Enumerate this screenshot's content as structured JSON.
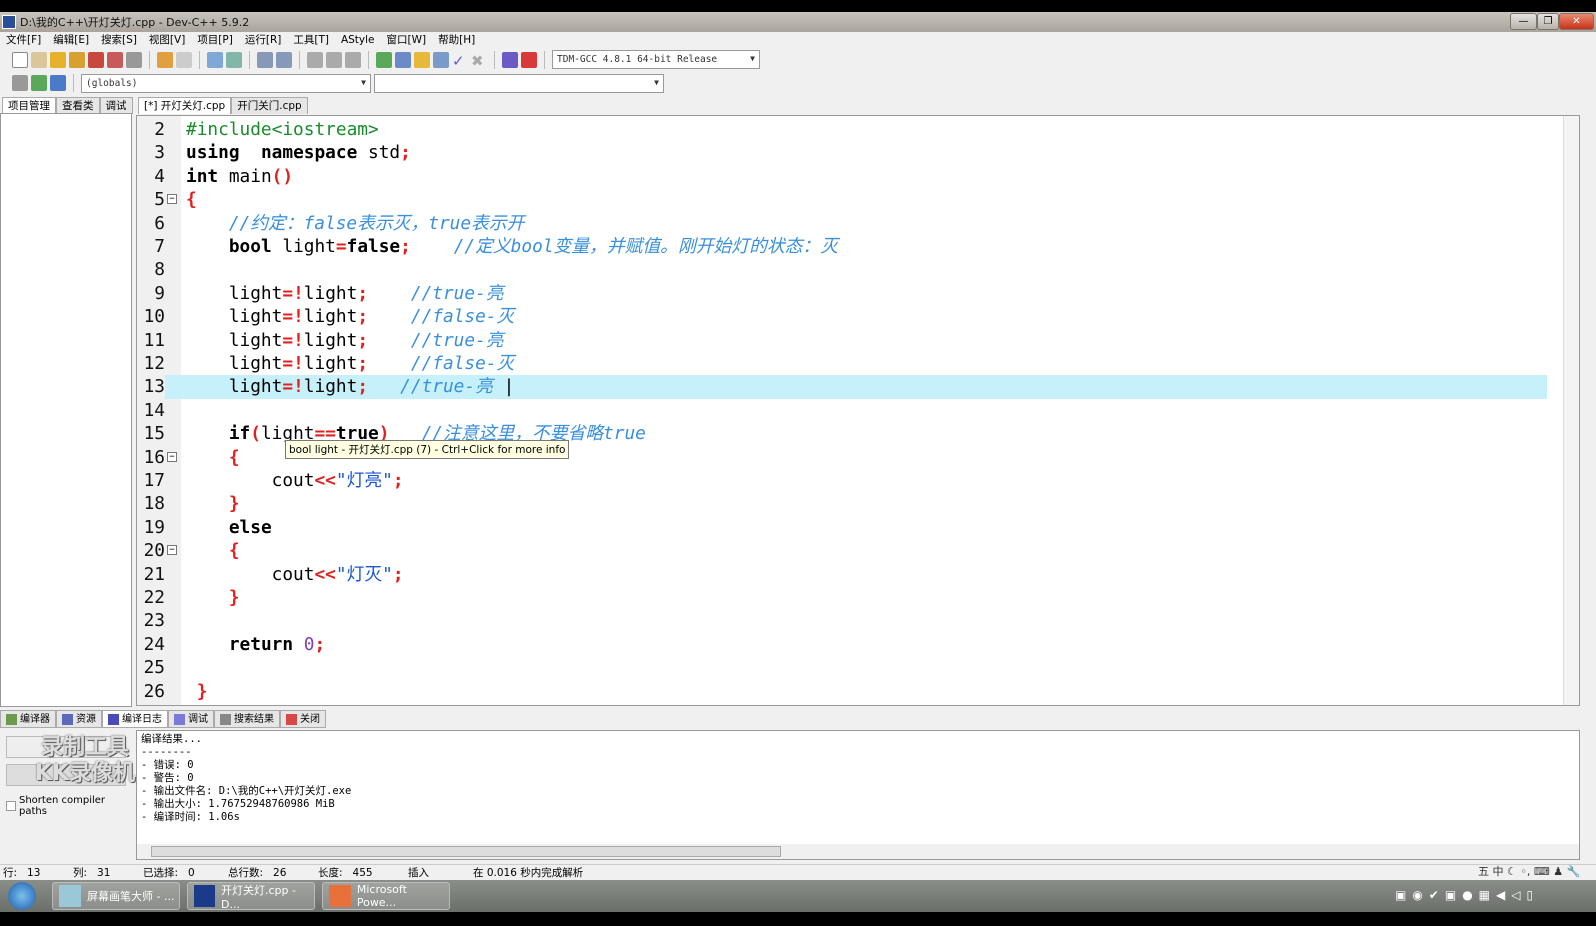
{
  "window": {
    "title": "D:\\我的C++\\开灯关灯.cpp - Dev-C++ 5.9.2",
    "min": "—",
    "max": "❐",
    "close": "✕"
  },
  "menu": [
    "文件[F]",
    "编辑[E]",
    "搜索[S]",
    "视图[V]",
    "项目[P]",
    "运行[R]",
    "工具[T]",
    "AStyle",
    "窗口[W]",
    "帮助[H]"
  ],
  "toolbar": {
    "compiler": "TDM-GCC 4.8.1 64-bit Release",
    "scope": "(globals)",
    "member": ""
  },
  "left_tabs": [
    "项目管理",
    "查看类",
    "调试"
  ],
  "editor_tabs": [
    "[*] 开灯关灯.cpp",
    "开门关门.cpp"
  ],
  "code": {
    "current_line": 13,
    "folds": [
      5,
      16,
      20
    ],
    "lines": [
      {
        "n": "2",
        "t": [
          [
            "pp",
            "#include<iostream>"
          ]
        ]
      },
      {
        "n": "3",
        "t": [
          [
            "kw",
            "using"
          ],
          [
            "",
            "  "
          ],
          [
            "kw",
            "namespace"
          ],
          [
            "",
            " std"
          ],
          [
            "op",
            ";"
          ]
        ]
      },
      {
        "n": "4",
        "t": [
          [
            "kw",
            "int"
          ],
          [
            "",
            " main"
          ],
          [
            "op",
            "()"
          ]
        ]
      },
      {
        "n": "5",
        "t": [
          [
            "op",
            "{"
          ]
        ]
      },
      {
        "n": "6",
        "t": [
          [
            "",
            "    "
          ],
          [
            "cm",
            "//约定：false表示灭，true表示开"
          ]
        ]
      },
      {
        "n": "7",
        "t": [
          [
            "",
            "    "
          ],
          [
            "kw",
            "bool"
          ],
          [
            "",
            " light"
          ],
          [
            "op",
            "="
          ],
          [
            "kw",
            "false"
          ],
          [
            "op",
            ";"
          ],
          [
            "",
            "    "
          ],
          [
            "cm",
            "//定义bool变量，并赋值。刚开始灯的状态：灭"
          ]
        ]
      },
      {
        "n": "8",
        "t": []
      },
      {
        "n": "9",
        "t": [
          [
            "",
            "    light"
          ],
          [
            "op",
            "=!"
          ],
          [
            "",
            "light"
          ],
          [
            "op",
            ";"
          ],
          [
            "",
            "    "
          ],
          [
            "cm",
            "//true-亮"
          ]
        ]
      },
      {
        "n": "10",
        "t": [
          [
            "",
            "    light"
          ],
          [
            "op",
            "=!"
          ],
          [
            "",
            "light"
          ],
          [
            "op",
            ";"
          ],
          [
            "",
            "    "
          ],
          [
            "cm",
            "//false-灭"
          ]
        ]
      },
      {
        "n": "11",
        "t": [
          [
            "",
            "    light"
          ],
          [
            "op",
            "=!"
          ],
          [
            "",
            "light"
          ],
          [
            "op",
            ";"
          ],
          [
            "",
            "    "
          ],
          [
            "cm",
            "//true-亮"
          ]
        ]
      },
      {
        "n": "12",
        "t": [
          [
            "",
            "    light"
          ],
          [
            "op",
            "=!"
          ],
          [
            "",
            "light"
          ],
          [
            "op",
            ";"
          ],
          [
            "",
            "    "
          ],
          [
            "cm",
            "//false-灭"
          ]
        ]
      },
      {
        "n": "13",
        "t": [
          [
            "",
            "    light"
          ],
          [
            "op",
            "=!"
          ],
          [
            "",
            "light"
          ],
          [
            "op",
            ";"
          ],
          [
            "",
            "   "
          ],
          [
            "cm",
            "//true-亮 "
          ],
          [
            "",
            "|"
          ]
        ]
      },
      {
        "n": "14",
        "t": []
      },
      {
        "n": "15",
        "t": [
          [
            "",
            "    "
          ],
          [
            "kw",
            "if"
          ],
          [
            "op",
            "("
          ],
          [
            "",
            "light"
          ],
          [
            "op",
            "=="
          ],
          [
            "kw",
            "true"
          ],
          [
            "op",
            ")"
          ],
          [
            "",
            "   "
          ],
          [
            "cm",
            "//注意这里，不要省略true"
          ]
        ]
      },
      {
        "n": "16",
        "t": [
          [
            "",
            "    "
          ],
          [
            "op",
            "{"
          ]
        ]
      },
      {
        "n": "17",
        "t": [
          [
            "",
            "        cout"
          ],
          [
            "op",
            "<<"
          ],
          [
            "str",
            "\"灯亮\""
          ],
          [
            "op",
            ";"
          ]
        ]
      },
      {
        "n": "18",
        "t": [
          [
            "",
            "    "
          ],
          [
            "op",
            "}"
          ]
        ]
      },
      {
        "n": "19",
        "t": [
          [
            "",
            "    "
          ],
          [
            "kw",
            "else"
          ]
        ]
      },
      {
        "n": "20",
        "t": [
          [
            "",
            "    "
          ],
          [
            "op",
            "{"
          ]
        ]
      },
      {
        "n": "21",
        "t": [
          [
            "",
            "        cout"
          ],
          [
            "op",
            "<<"
          ],
          [
            "str",
            "\"灯灭\""
          ],
          [
            "op",
            ";"
          ]
        ]
      },
      {
        "n": "22",
        "t": [
          [
            "",
            "    "
          ],
          [
            "op",
            "}"
          ]
        ]
      },
      {
        "n": "23",
        "t": []
      },
      {
        "n": "24",
        "t": [
          [
            "",
            "    "
          ],
          [
            "kw",
            "return"
          ],
          [
            "",
            " "
          ],
          [
            "num",
            "0"
          ],
          [
            "op",
            ";"
          ]
        ]
      },
      {
        "n": "25",
        "t": []
      },
      {
        "n": "26",
        "t": [
          [
            "",
            " "
          ],
          [
            "op",
            "}"
          ]
        ]
      }
    ]
  },
  "tooltip": "bool light - 开灯关灯.cpp (7) - Ctrl+Click for more info",
  "bottom_tabs": [
    "编译器",
    "资源",
    "编译日志",
    "调试",
    "搜索结果",
    "关闭"
  ],
  "shorten_paths": "Shorten compiler paths",
  "watermark": "录制工具 KK录像机",
  "output": [
    "编译结果...",
    "--------",
    "- 错误: 0",
    "- 警告: 0",
    "- 输出文件名: D:\\我的C++\\开灯关灯.exe",
    "- 输出大小: 1.76752948760986 MiB",
    "- 编译时间: 1.06s"
  ],
  "status": [
    {
      "label": "行:",
      "value": "13"
    },
    {
      "label": "列:",
      "value": "31"
    },
    {
      "label": "已选择:",
      "value": "0"
    },
    {
      "label": "总行数:",
      "value": "26"
    },
    {
      "label": "长度:",
      "value": "455"
    },
    {
      "label": "",
      "value": "插入"
    },
    {
      "label": "",
      "value": "在 0.016 秒内完成解析"
    }
  ],
  "taskbar": [
    "屏幕画笔大师 - ...",
    "开灯关灯.cpp - D...",
    "Microsoft Powe..."
  ],
  "ime": "五 中"
}
